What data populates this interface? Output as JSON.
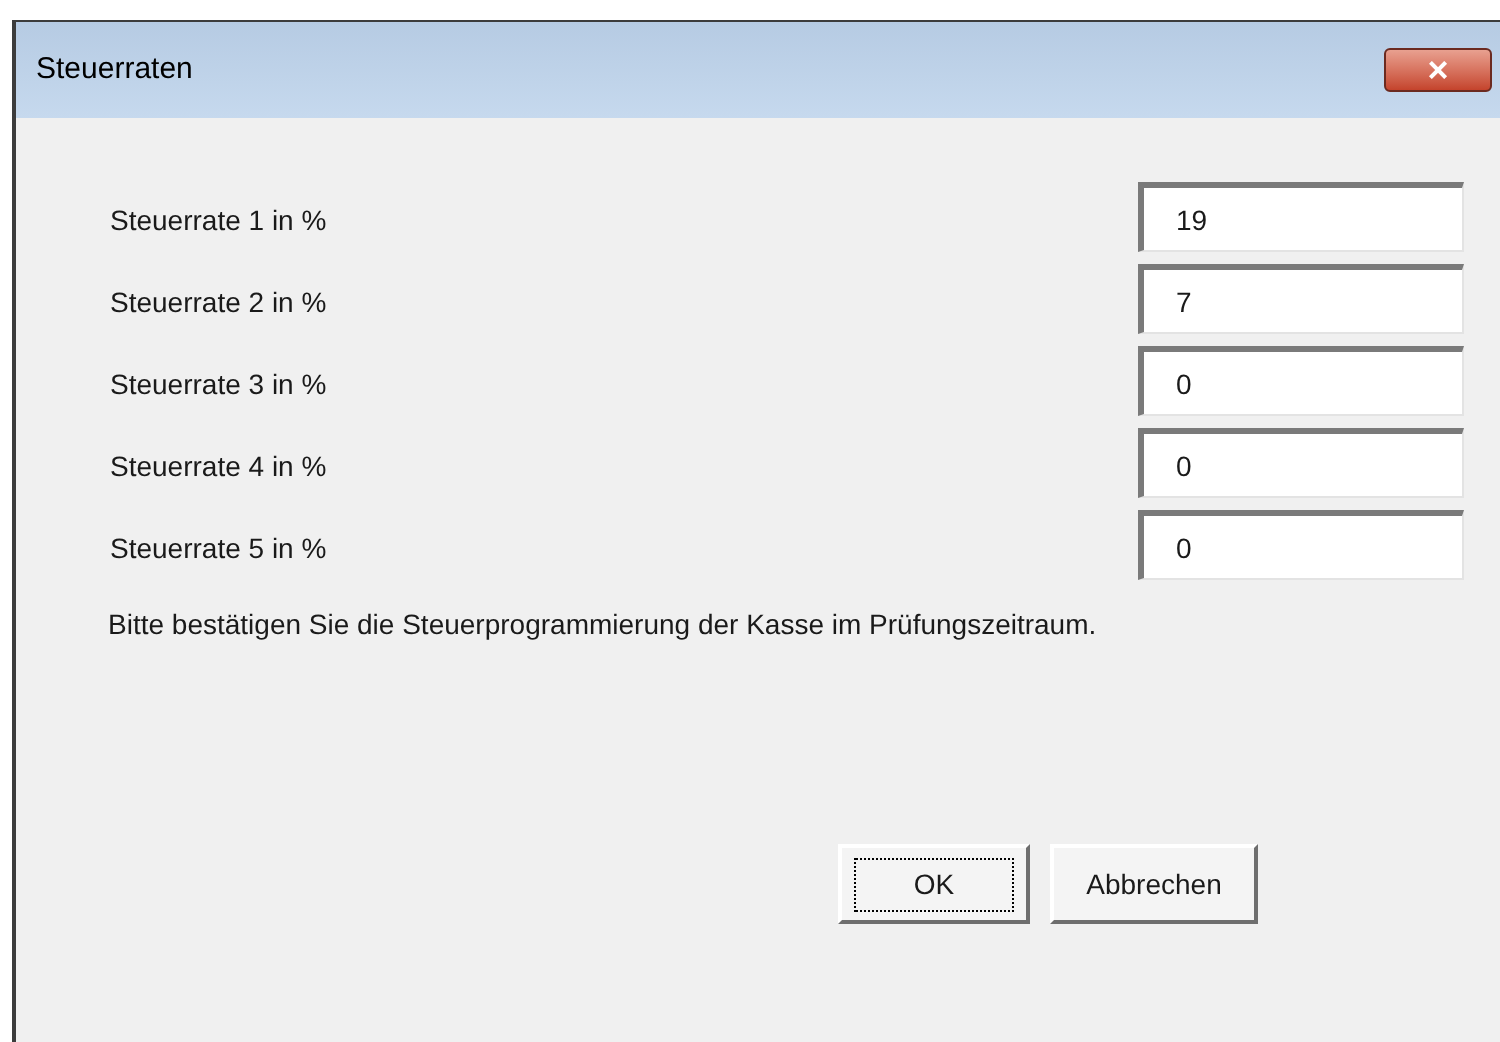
{
  "window": {
    "title": "Steuerraten",
    "close": "×"
  },
  "fields": [
    {
      "label": "Steuerrate 1 in %",
      "value": "19"
    },
    {
      "label": "Steuerrate 2 in %",
      "value": "7"
    },
    {
      "label": "Steuerrate 3 in %",
      "value": "0"
    },
    {
      "label": "Steuerrate 4 in %",
      "value": "0"
    },
    {
      "label": "Steuerrate 5 in %",
      "value": "0"
    }
  ],
  "message": "Bitte bestätigen Sie die Steuerprogrammierung der Kasse im Prüfungszeitraum.",
  "buttons": [
    {
      "label": "OK",
      "focused": true
    },
    {
      "label": "Abbrechen",
      "focused": false
    }
  ]
}
